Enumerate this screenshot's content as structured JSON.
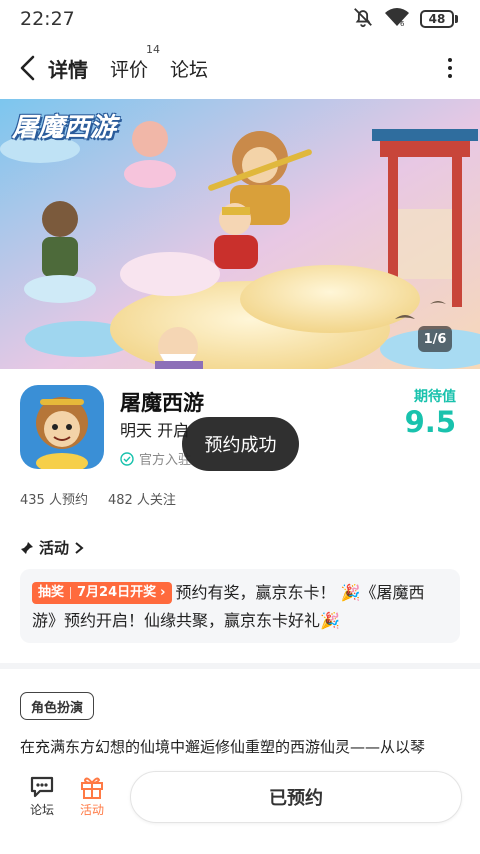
{
  "status_bar": {
    "time": "22:27",
    "battery": "48",
    "icons": [
      "bell-off-icon",
      "wifi-icon",
      "battery-icon"
    ]
  },
  "nav": {
    "tabs": [
      {
        "label": "详情",
        "active": true
      },
      {
        "label": "评价",
        "badge": "14"
      },
      {
        "label": "论坛"
      }
    ]
  },
  "banner": {
    "title": "屠魔西游",
    "pager": "1/6"
  },
  "app": {
    "name": "屠魔西游",
    "time_text": "明天 开启",
    "official_text": "官方入驻",
    "rating_label": "期待值",
    "rating_value": "9.5",
    "reservations": "435 人预约",
    "followers": "482 人关注"
  },
  "toast": "预约成功",
  "activity": {
    "heading": "活动",
    "badge_left": "抽奖",
    "badge_right": "7月24日开奖",
    "text": "预约有奖，赢京东卡！ 🎉《屠魔西游》预约开启！仙缘共聚，赢京东卡好礼🎉"
  },
  "tag": "角色扮演",
  "description": "在充满东方幻想的仙境中邂逅修仙重塑的西游仙灵——从以琴",
  "bottom": {
    "forum_label": "论坛",
    "activity_label": "活动",
    "reserved_label": "已预约"
  },
  "colors": {
    "accent": "#19c2ad",
    "tab_underline": "#2ad1bf",
    "badge": "#ff6a3d",
    "activity_icon": "#ff7a45"
  }
}
